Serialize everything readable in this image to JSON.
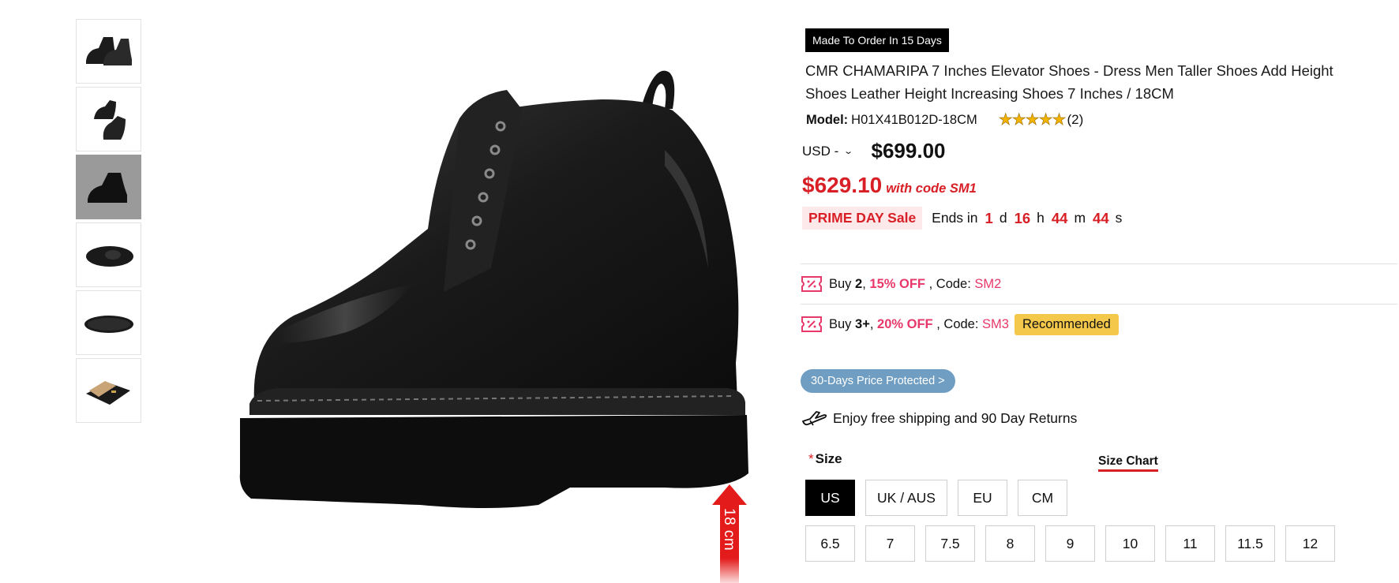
{
  "gallery": {
    "thumbnails": [
      {
        "alt": "boots-pair-side"
      },
      {
        "alt": "boots-pair-angle"
      },
      {
        "alt": "boot-side-dark"
      },
      {
        "alt": "boot-top"
      },
      {
        "alt": "boot-sole"
      },
      {
        "alt": "shoe-box"
      }
    ],
    "height_marker": "18 cm"
  },
  "product": {
    "badge": "Made To Order In 15 Days",
    "title": "CMR CHAMARIPA 7 Inches Elevator Shoes - Dress Men Taller Shoes Add Height Shoes Leather Height Increasing Shoes 7 Inches / 18CM",
    "model_label": "Model:",
    "model_value": "H01X41B012D-18CM",
    "rating_count": "(2)",
    "currency": "USD -",
    "price": "$699.00",
    "sale_price": "$629.10",
    "sale_code": "with code SM1"
  },
  "promo": {
    "prime_label": "PRIME DAY Sale",
    "ends_label": "Ends in",
    "countdown": [
      {
        "num": "1",
        "unit": "d"
      },
      {
        "num": "16",
        "unit": "h"
      },
      {
        "num": "44",
        "unit": "m"
      },
      {
        "num": "44",
        "unit": "s"
      }
    ]
  },
  "coupons": [
    {
      "buy": "Buy",
      "qty": "2",
      "sep": ",",
      "off": "15% OFF",
      "code_label": ", Code:",
      "code": "SM2",
      "badge": ""
    },
    {
      "buy": "Buy",
      "qty": "3+",
      "sep": ",",
      "off": "20% OFF",
      "code_label": ", Code:",
      "code": "SM3",
      "badge": "Recommended"
    }
  ],
  "price_protect": "30-Days Price Protected >",
  "shipping": "Enjoy free shipping and 90 Day Returns",
  "size": {
    "required_mark": "*",
    "label": "Size",
    "chart_link": "Size Chart",
    "units": [
      "US",
      "UK / AUS",
      "EU",
      "CM"
    ],
    "selected_unit": "US",
    "values": [
      "6.5",
      "7",
      "7.5",
      "8",
      "9",
      "10",
      "11",
      "11.5",
      "12"
    ]
  },
  "colors": {
    "sale_red": "#d81f26",
    "coupon_pink": "#e8386a",
    "recommended_yellow": "#f4c84a",
    "protect_blue": "#6f9ec2"
  }
}
